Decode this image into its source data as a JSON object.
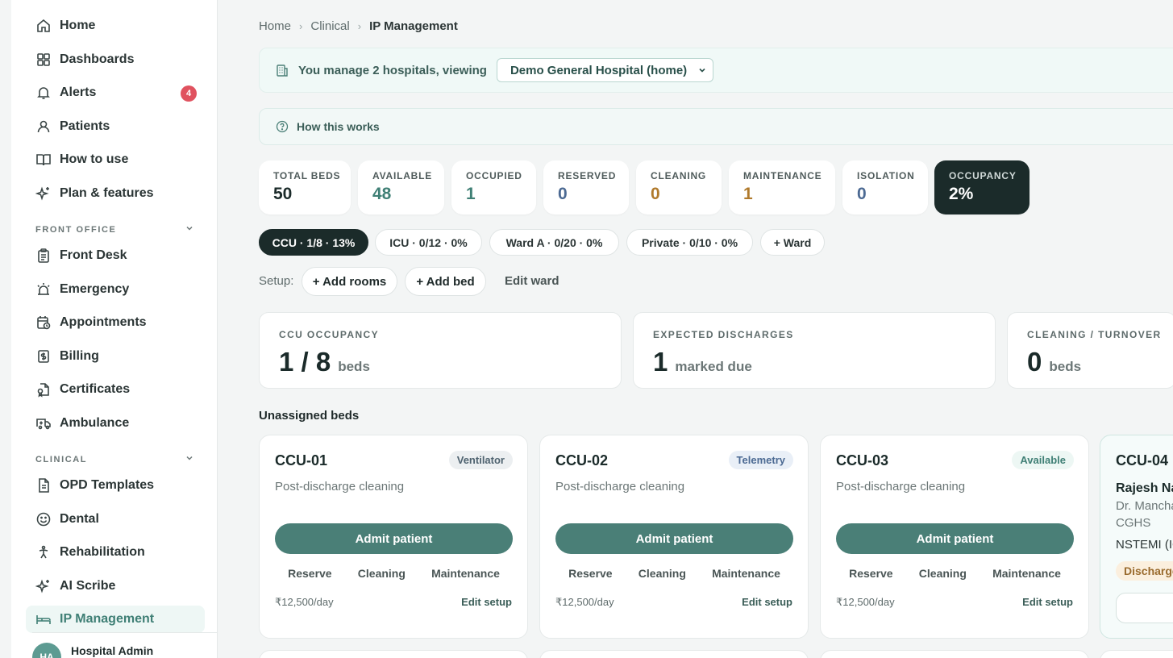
{
  "sidebar": {
    "items": [
      {
        "label": "Home"
      },
      {
        "label": "Dashboards"
      },
      {
        "label": "Alerts",
        "badge": "4"
      },
      {
        "label": "Patients"
      },
      {
        "label": "How to use"
      },
      {
        "label": "Plan & features"
      }
    ],
    "front_office": {
      "title": "FRONT OFFICE",
      "items": [
        {
          "label": "Front Desk"
        },
        {
          "label": "Emergency"
        },
        {
          "label": "Appointments"
        },
        {
          "label": "Billing"
        },
        {
          "label": "Certificates"
        },
        {
          "label": "Ambulance"
        }
      ]
    },
    "clinical": {
      "title": "CLINICAL",
      "items": [
        {
          "label": "OPD Templates"
        },
        {
          "label": "Dental"
        },
        {
          "label": "Rehabilitation"
        },
        {
          "label": "AI Scribe"
        },
        {
          "label": "IP Management"
        }
      ]
    },
    "user": {
      "initials": "HA",
      "name": "Hospital Admin"
    }
  },
  "breadcrumb": [
    "Home",
    "Clinical",
    "IP Management"
  ],
  "hospital_banner": {
    "text": "You manage 2 hospitals, viewing",
    "selected": "Demo General Hospital (home)"
  },
  "how_this_works": "How this works",
  "stats": [
    {
      "label": "TOTAL BEDS",
      "value": "50",
      "color": "#1b2b2a"
    },
    {
      "label": "AVAILABLE",
      "value": "48",
      "color": "#3f7f75"
    },
    {
      "label": "OCCUPIED",
      "value": "1",
      "color": "#3f7f75"
    },
    {
      "label": "RESERVED",
      "value": "0",
      "color": "#4c6a93"
    },
    {
      "label": "CLEANING",
      "value": "0",
      "color": "#b07a2c"
    },
    {
      "label": "MAINTENANCE",
      "value": "1",
      "color": "#b07a2c"
    },
    {
      "label": "ISOLATION",
      "value": "0",
      "color": "#4c6a93"
    },
    {
      "label": "OCCUPANCY",
      "value": "2%",
      "color": "#ffffff"
    }
  ],
  "ward_chips": [
    "CCU · 1/8 · 13%",
    "ICU · 0/12 · 0%",
    "Ward A · 0/20 · 0%",
    "Private · 0/10 · 0%",
    "+ Ward"
  ],
  "setup": {
    "label": "Setup:",
    "add_rooms": "+ Add rooms",
    "add_bed": "+ Add bed",
    "edit_ward": "Edit ward"
  },
  "summaries": [
    {
      "label": "CCU OCCUPANCY",
      "big": "1 / 8",
      "unit": "beds"
    },
    {
      "label": "EXPECTED DISCHARGES",
      "big": "1",
      "unit": "marked due"
    },
    {
      "label": "CLEANING / TURNOVER",
      "big": "0",
      "unit": "beds"
    }
  ],
  "unassigned_title": "Unassigned beds",
  "beds": [
    {
      "name": "CCU-01",
      "tag": "Ventilator",
      "status": "Post-discharge cleaning",
      "admit": "Admit patient",
      "actions": [
        "Reserve",
        "Cleaning",
        "Maintenance"
      ],
      "rate": "₹12,500/day",
      "edit": "Edit setup"
    },
    {
      "name": "CCU-02",
      "tag": "Telemetry",
      "status": "Post-discharge cleaning",
      "admit": "Admit patient",
      "actions": [
        "Reserve",
        "Cleaning",
        "Maintenance"
      ],
      "rate": "₹12,500/day",
      "edit": "Edit setup"
    },
    {
      "name": "CCU-03",
      "tag": "Available",
      "status": "Post-discharge cleaning",
      "admit": "Admit patient",
      "actions": [
        "Reserve",
        "Cleaning",
        "Maintenance"
      ],
      "rate": "₹12,500/day",
      "edit": "Edit setup"
    }
  ],
  "occupied_bed": {
    "name": "CCU-04",
    "patient": "Rajesh Na",
    "doctor": "Dr. Mancha",
    "insurance": "CGHS",
    "diagnosis": "NSTEMI (IC",
    "discharge_chip": "Discharge"
  }
}
